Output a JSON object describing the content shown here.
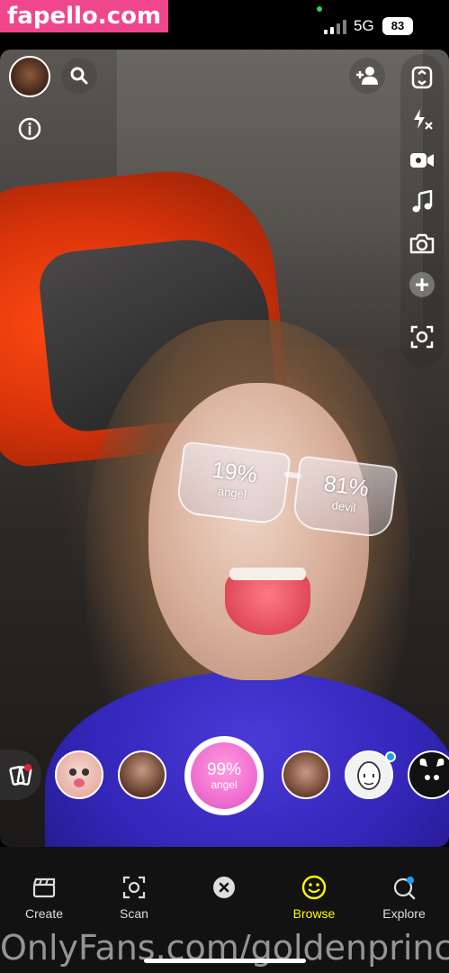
{
  "watermarks": {
    "top": "fapello.com",
    "bottom": "OnlyFans.com/goldenprinc"
  },
  "status_bar": {
    "network": "5G",
    "battery": "83"
  },
  "ar_lens": {
    "left_percent": "19%",
    "left_label": "angel",
    "right_percent": "81%",
    "right_label": "devil"
  },
  "capture_button": {
    "percent": "99%",
    "label": "angel"
  },
  "top_left": {
    "avatar": "profile-avatar",
    "search_icon": "search-icon",
    "info_icon": "info-icon"
  },
  "top_right": {
    "add_friend_icon": "add-friend-icon"
  },
  "right_rail": {
    "icons": [
      "flip-camera-icon",
      "flash-off-icon",
      "video-chat-icon",
      "music-icon",
      "camera-timer-icon",
      "plus-icon",
      "scan-focus-icon"
    ]
  },
  "carousel": {
    "items": [
      "baby-face-lens",
      "portrait-lens",
      "capture",
      "face-lens",
      "egg-face-lens",
      "devil-horns-lens"
    ],
    "notification_color": "#1a9df0"
  },
  "bottom_nav": {
    "items": [
      {
        "label": "Create",
        "icon": "clapper-icon"
      },
      {
        "label": "Scan",
        "icon": "scan-icon"
      },
      {
        "label": "",
        "icon": "close-icon"
      },
      {
        "label": "Browse",
        "icon": "smile-icon"
      },
      {
        "label": "Explore",
        "icon": "explore-icon"
      }
    ],
    "active_color": "#fffc00"
  }
}
